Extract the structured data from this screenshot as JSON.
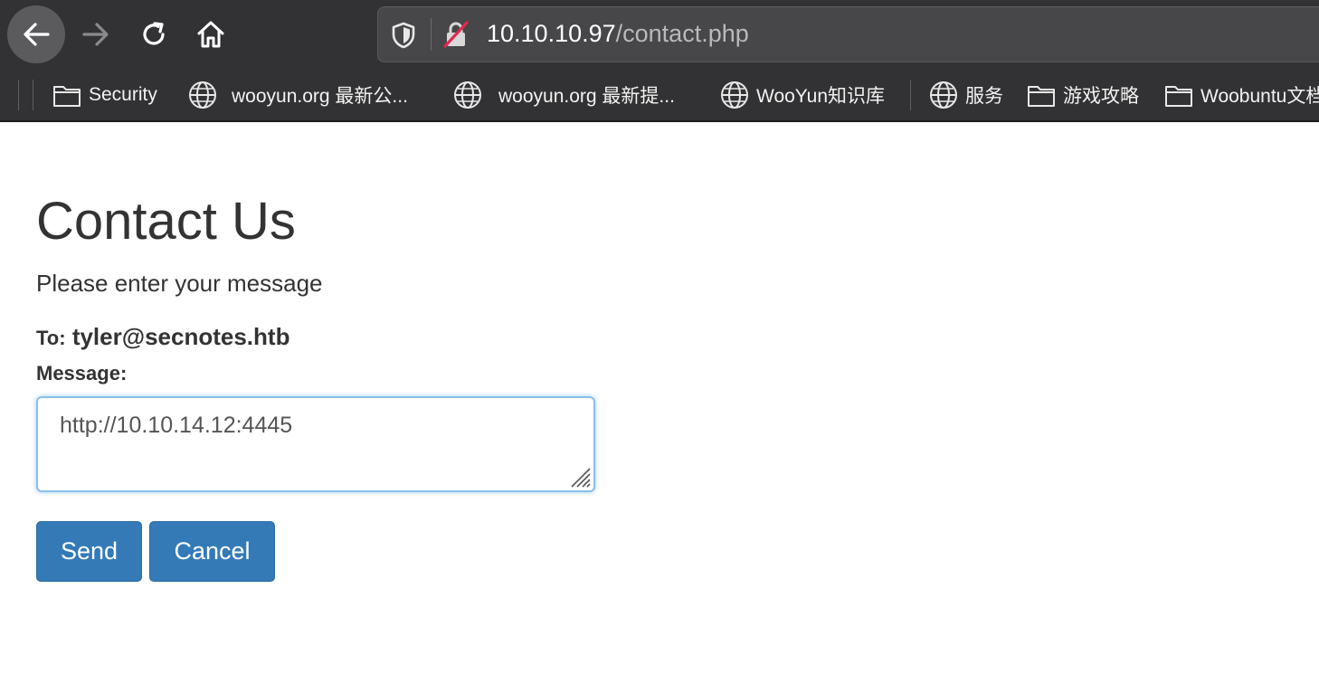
{
  "browser": {
    "url_host": "10.10.10.97",
    "url_path": "/contact.php"
  },
  "bookmarks": [
    {
      "label": "Security",
      "icon": "folder-icon"
    },
    {
      "label": "wooyun.org 最新公...",
      "icon": "globe-icon"
    },
    {
      "label": "wooyun.org 最新提...",
      "icon": "globe-icon"
    },
    {
      "label": "WooYun知识库",
      "icon": "globe-icon"
    },
    {
      "label": "服务",
      "icon": "globe-icon"
    },
    {
      "label": "游戏攻略",
      "icon": "folder-icon"
    },
    {
      "label": "Woobuntu文档",
      "icon": "folder-icon"
    }
  ],
  "page": {
    "title": "Contact Us",
    "subtitle": "Please enter your message",
    "to_label": "To:",
    "to_value": "tyler@secnotes.htb",
    "message_label": "Message:",
    "message_value": "http://10.10.14.12:4445",
    "send_label": "Send",
    "cancel_label": "Cancel"
  },
  "colors": {
    "toolbar_bg": "#323234",
    "button_primary": "#337ab7",
    "text": "#333333"
  }
}
